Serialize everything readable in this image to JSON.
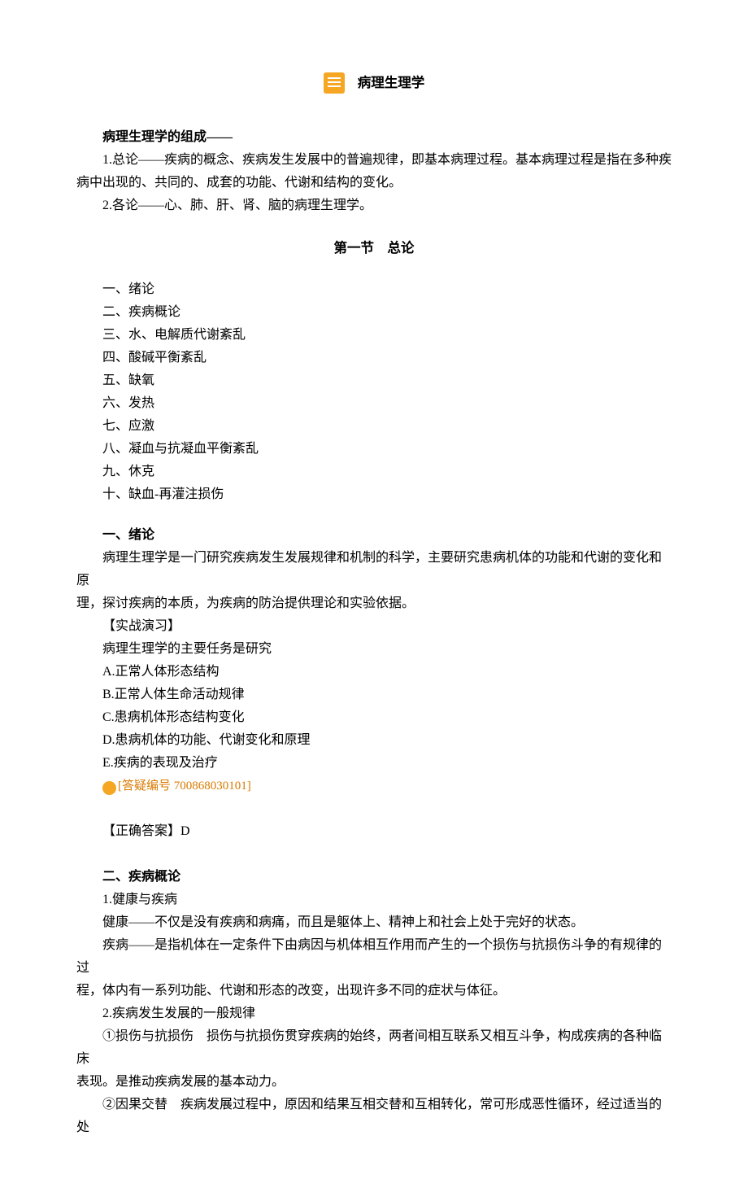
{
  "title": "病理生理学",
  "intro_heading": "病理生理学的组成——",
  "intro_p1_a": "1.总论——疾病的概念、疾病发生发展中的普遍规律，即基本病理过程。基本病理过程是指在多种疾",
  "intro_p1_b": "病中出现的、共同的、成套的功能、代谢和结构的变化。",
  "intro_p2": "2.各论——心、肺、肝、肾、脑的病理生理学。",
  "section1_title": "第一节　总论",
  "outline": [
    "一、绪论",
    "二、疾病概论",
    "三、水、电解质代谢紊乱",
    "四、酸碱平衡紊乱",
    "五、缺氧",
    "六、发热",
    "七、应激",
    "八、凝血与抗凝血平衡紊乱",
    "九、休克",
    "十、缺血-再灌注损伤"
  ],
  "h1": "一、绪论",
  "h1_p1_a": "病理生理学是一门研究疾病发生发展规律和机制的科学，主要研究患病机体的功能和代谢的变化和原",
  "h1_p1_b": "理，探讨疾病的本质，为疾病的防治提供理论和实验依据。",
  "exercise_label": "【实战演习】",
  "q_stem": "病理生理学的主要任务是研究",
  "q_options": [
    "A.正常人体形态结构",
    "B.正常人体生命活动规律",
    "C.患病机体形态结构变化",
    "D.患病机体的功能、代谢变化和原理",
    "E.疾病的表现及治疗"
  ],
  "qmark": "?",
  "answer_code": "[答疑编号 700868030101]",
  "correct": "【正确答案】D",
  "h2": "二、疾病概论",
  "h2_p1": "1.健康与疾病",
  "h2_p2": "健康——不仅是没有疾病和病痛，而且是躯体上、精神上和社会上处于完好的状态。",
  "h2_p3_a": "疾病——是指机体在一定条件下由病因与机体相互作用而产生的一个损伤与抗损伤斗争的有规律的过",
  "h2_p3_b": "程，体内有一系列功能、代谢和形态的改变，出现许多不同的症状与体征。",
  "h2_p4": "2.疾病发生发展的一般规律",
  "h2_p5_a": "①损伤与抗损伤　损伤与抗损伤贯穿疾病的始终，两者间相互联系又相互斗争，构成疾病的各种临床",
  "h2_p5_b": "表现。是推动疾病发展的基本动力。",
  "h2_p6": "②因果交替　疾病发展过程中，原因和结果互相交替和互相转化，常可形成恶性循环，经过适当的处"
}
